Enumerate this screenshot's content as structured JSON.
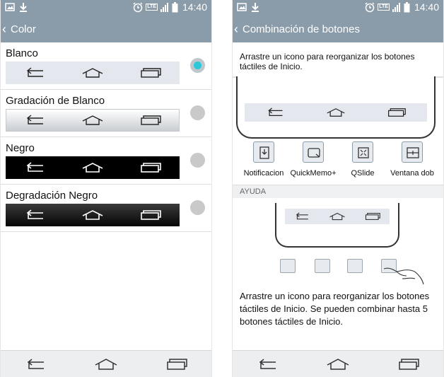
{
  "status": {
    "time": "14:40",
    "network": "LTE"
  },
  "left": {
    "title": "Color",
    "options": [
      {
        "label": "Blanco",
        "style": "white",
        "selected": true
      },
      {
        "label": "Gradación de Blanco",
        "style": "gradwhite",
        "selected": false
      },
      {
        "label": "Negro",
        "style": "black",
        "selected": false
      },
      {
        "label": "Degradación Negro",
        "style": "gradblack",
        "selected": false
      }
    ]
  },
  "right": {
    "title": "Combinación de botones",
    "instruction": "Arrastre un icono para reorganizar los botones táctiles de Inicio.",
    "buttons": [
      {
        "label": "Notificacion",
        "icon": "notification-icon"
      },
      {
        "label": "QuickMemo+",
        "icon": "quickmemo-icon"
      },
      {
        "label": "QSlide",
        "icon": "qslide-icon"
      },
      {
        "label": "Ventana dob",
        "icon": "dual-window-icon"
      }
    ],
    "help_header": "AYUDA",
    "help_text": "Arrastre un icono para reorganizar los botones táctiles de Inicio. Se pueden combinar hasta 5 botones táctiles de Inicio."
  },
  "colors": {
    "bar": "#8a9baa",
    "accent": "#2ac8d8"
  }
}
